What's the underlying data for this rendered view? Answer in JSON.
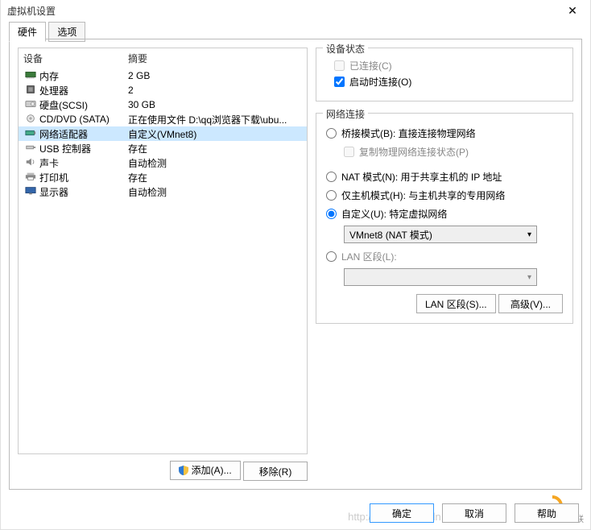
{
  "window": {
    "title": "虚拟机设置"
  },
  "tabs": {
    "hardware": "硬件",
    "options": "选项"
  },
  "device_header": {
    "device": "设备",
    "summary": "摘要"
  },
  "devices": [
    {
      "name": "内存",
      "summary": "2 GB"
    },
    {
      "name": "处理器",
      "summary": "2"
    },
    {
      "name": "硬盘(SCSI)",
      "summary": "30 GB"
    },
    {
      "name": "CD/DVD (SATA)",
      "summary": "正在使用文件 D:\\qq浏览器下载\\ubu..."
    },
    {
      "name": "网络适配器",
      "summary": "自定义(VMnet8)"
    },
    {
      "name": "USB 控制器",
      "summary": "存在"
    },
    {
      "name": "声卡",
      "summary": "自动检测"
    },
    {
      "name": "打印机",
      "summary": "存在"
    },
    {
      "name": "显示器",
      "summary": "自动检测"
    }
  ],
  "left_buttons": {
    "add": "添加(A)...",
    "remove": "移除(R)"
  },
  "status_group": {
    "title": "设备状态",
    "connected": "已连接(C)",
    "connect_poweron": "启动时连接(O)"
  },
  "net_group": {
    "title": "网络连接",
    "bridged": "桥接模式(B): 直接连接物理网络",
    "replicate": "复制物理网络连接状态(P)",
    "nat": "NAT 模式(N): 用于共享主机的 IP 地址",
    "hostonly": "仅主机模式(H): 与主机共享的专用网络",
    "custom": "自定义(U): 特定虚拟网络",
    "custom_value": "VMnet8 (NAT 模式)",
    "lanseg": "LAN 区段(L):",
    "lanseg_value": "",
    "lanseg_btn": "LAN 区段(S)...",
    "adv_btn": "高级(V)..."
  },
  "bottom": {
    "ok": "确定",
    "cancel": "取消",
    "help": "帮助"
  },
  "watermark": "http://www.cog.csdn.net/"
}
